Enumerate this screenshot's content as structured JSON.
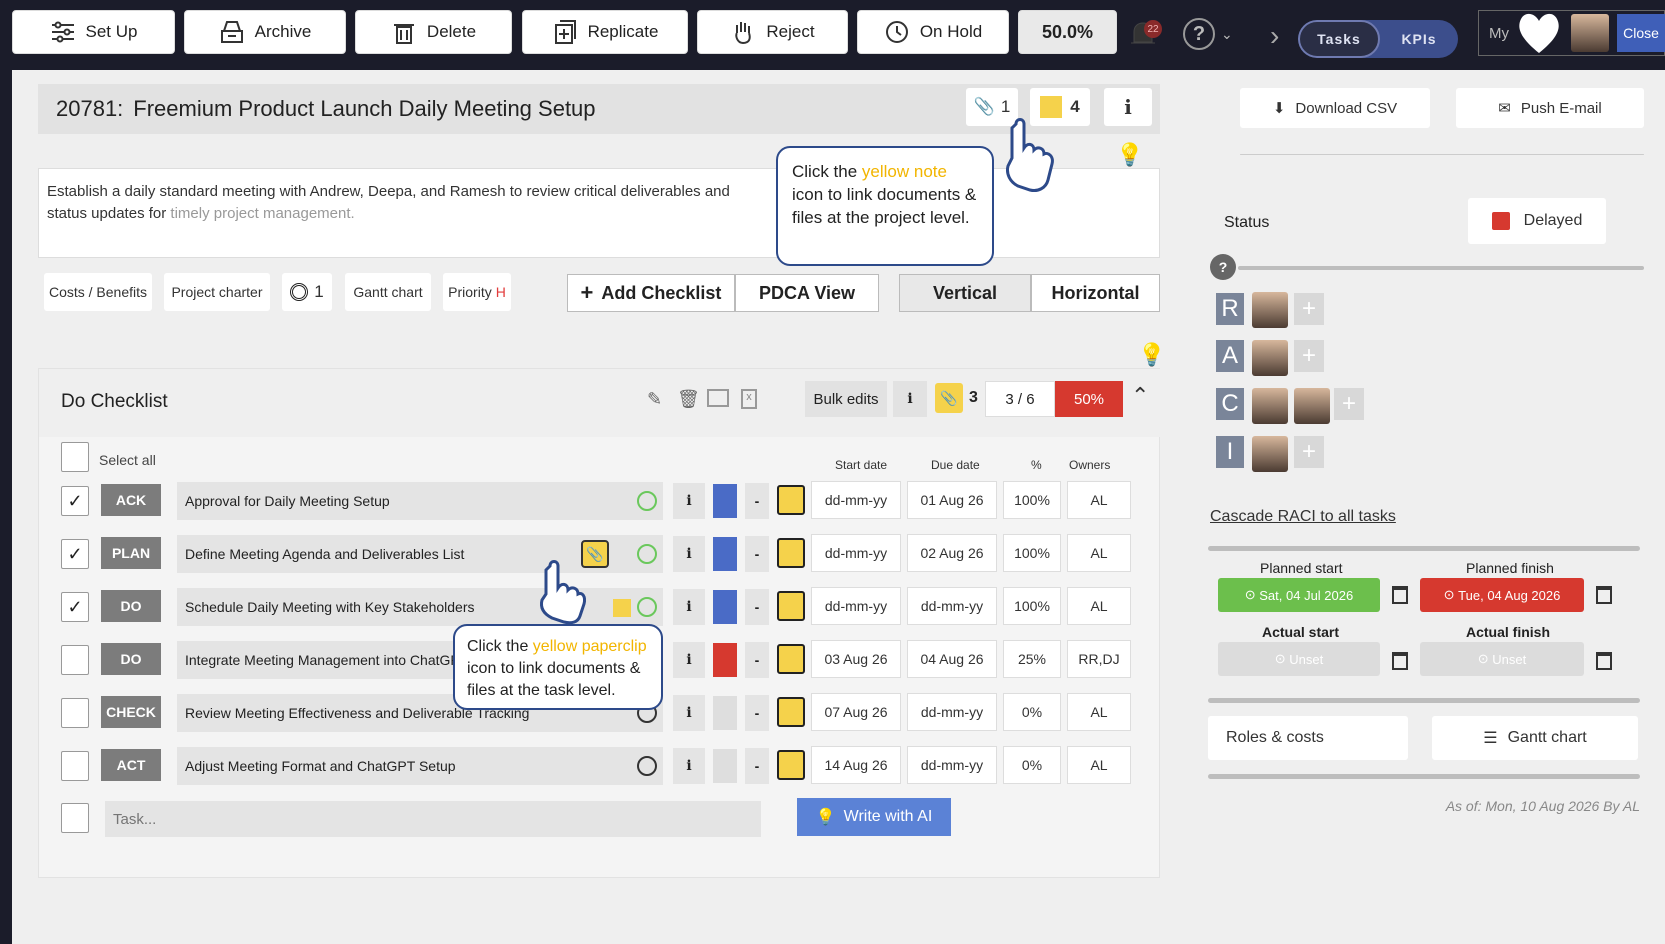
{
  "toolbar": {
    "setup": "Set Up",
    "archive": "Archive",
    "delete": "Delete",
    "replicate": "Replicate",
    "reject": "Reject",
    "onhold": "On Hold",
    "progress": "50.0%",
    "notifications": "22",
    "tabs": [
      "Tasks",
      "KPIs"
    ],
    "my": "My",
    "close": "Close"
  },
  "project": {
    "id": "20781:",
    "title": "Freemium Product Launch Daily Meeting Setup",
    "attachments": "1",
    "notes": "4",
    "description": "Establish a daily standard meeting with Andrew, Deepa, and Ramesh to review critical deliverables and status updates for",
    "description_tail": "timely project management.",
    "chips": {
      "costs": "Costs / Benefits",
      "charter": "Project charter",
      "target_count": "1",
      "gantt": "Gantt chart",
      "priority_label": "Priority",
      "priority_value": "H"
    },
    "buttons": {
      "add_checklist": "Add Checklist",
      "pdca": "PDCA View",
      "vertical": "Vertical",
      "horizontal": "Horizontal"
    }
  },
  "callouts": {
    "note": {
      "pre": "Click the ",
      "hl": "yellow note",
      "post": " icon to link documents & files at the project level."
    },
    "clip": {
      "pre": "Click the ",
      "hl": "yellow paperclip",
      "post": " icon to link documents & files at the task level."
    }
  },
  "checklist": {
    "title": "Do Checklist",
    "bulk": "Bulk edits",
    "clip_count": "3",
    "done": "3 / 6",
    "pct": "50%",
    "select_all": "Select all",
    "headers": {
      "start": "Start date",
      "due": "Due date",
      "pct": "%",
      "owners": "Owners"
    },
    "tasks": [
      {
        "checked": true,
        "phase": "ACK",
        "name": "Approval for Daily Meeting Setup",
        "color": "#4a6bc6",
        "start": "dd-mm-yy",
        "due": "01 Aug 26",
        "pct": "100%",
        "owners": "AL"
      },
      {
        "checked": true,
        "phase": "PLAN",
        "name": "Define Meeting Agenda and Deliverables List",
        "color": "#4a6bc6",
        "start": "dd-mm-yy",
        "due": "02 Aug 26",
        "pct": "100%",
        "owners": "AL"
      },
      {
        "checked": true,
        "phase": "DO",
        "name": "Schedule Daily Meeting with Key Stakeholders",
        "color": "#4a6bc6",
        "start": "dd-mm-yy",
        "due": "dd-mm-yy",
        "pct": "100%",
        "owners": "AL"
      },
      {
        "checked": false,
        "phase": "DO",
        "name": "Integrate Meeting Management into ChatGPT",
        "color": "#d6392f",
        "start": "03 Aug 26",
        "due": "04 Aug 26",
        "pct": "25%",
        "owners": "RR,DJ"
      },
      {
        "checked": false,
        "phase": "CHECK",
        "name": "Review Meeting Effectiveness and Deliverable Tracking",
        "color": "#dedede",
        "start": "07 Aug 26",
        "due": "dd-mm-yy",
        "pct": "0%",
        "owners": "AL"
      },
      {
        "checked": false,
        "phase": "ACT",
        "name": "Adjust Meeting Format and ChatGPT Setup",
        "color": "#dedede",
        "start": "14 Aug 26",
        "due": "dd-mm-yy",
        "pct": "0%",
        "owners": "AL"
      }
    ],
    "task_placeholder": "Task...",
    "write_ai": "Write with AI"
  },
  "side": {
    "download": "Download CSV",
    "email": "Push E-mail",
    "status_label": "Status",
    "status_value": "Delayed",
    "raci": [
      "R",
      "A",
      "C",
      "I"
    ],
    "cascade": "Cascade RACI to all tasks",
    "planned_start_label": "Planned start",
    "planned_finish_label": "Planned finish",
    "planned_start": "Sat, 04 Jul 2026",
    "planned_finish": "Tue, 04 Aug 2026",
    "actual_start_label": "Actual start",
    "actual_finish_label": "Actual finish",
    "unset": "Unset",
    "roles": "Roles & costs",
    "gantt": "Gantt chart",
    "asof": "As of: Mon, 10 Aug 2026 By AL"
  },
  "colors": {
    "accent": "#4a6bc6",
    "delayed": "#d6392f",
    "ok": "#6cbf4c",
    "note": "#f5d24b"
  }
}
